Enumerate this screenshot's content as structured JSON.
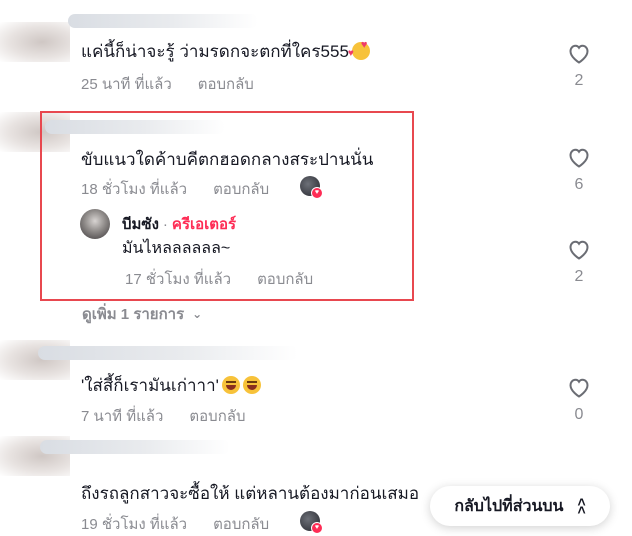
{
  "comments": [
    {
      "text": "แค่นี้ก็น่าจะรู้ ว่ามรดกจะตกที่ใคร555",
      "emoji": "love",
      "time": "25 นาที ที่แล้ว",
      "reply_label": "ตอบกลับ",
      "likes": "2"
    },
    {
      "text": "ขับแนวใดค้าบคีตกฮอดกลางสระปานนั่น",
      "time": "18 ชั่วโมง ที่แล้ว",
      "reply_label": "ตอบกลับ",
      "likes": "6"
    },
    {
      "text": "'ใส่สี้ก็เรามันเก่าาา'",
      "emoji": "laugh",
      "time": "7 นาที ที่แล้ว",
      "reply_label": "ตอบกลับ",
      "likes": "0"
    },
    {
      "text": "ถึงรถลูกสาวจะซื้อให้ แต่หลานต้องมาก่อนเสมอ",
      "time": "19 ชั่วโมง ที่แล้ว",
      "reply_label": "ตอบกลับ"
    }
  ],
  "reply": {
    "author": "บีมซัง",
    "separator": "·",
    "badge": "ครีเอเตอร์",
    "text": "มันไหลลลลลล~",
    "time": "17 ชั่วโมง ที่แล้ว",
    "reply_label": "ตอบกลับ",
    "likes": "2"
  },
  "view_more": {
    "label": "ดูเพิ่ม 1 รายการ"
  },
  "back_to_top": {
    "label": "กลับไปที่ส่วนบน"
  },
  "colors": {
    "accent": "#fe2c55",
    "highlight": "#e8484f",
    "muted": "#8a8b91"
  },
  "icons": [
    "heart-outline-icon",
    "chevron-down-icon",
    "chevron-double-up-icon"
  ]
}
